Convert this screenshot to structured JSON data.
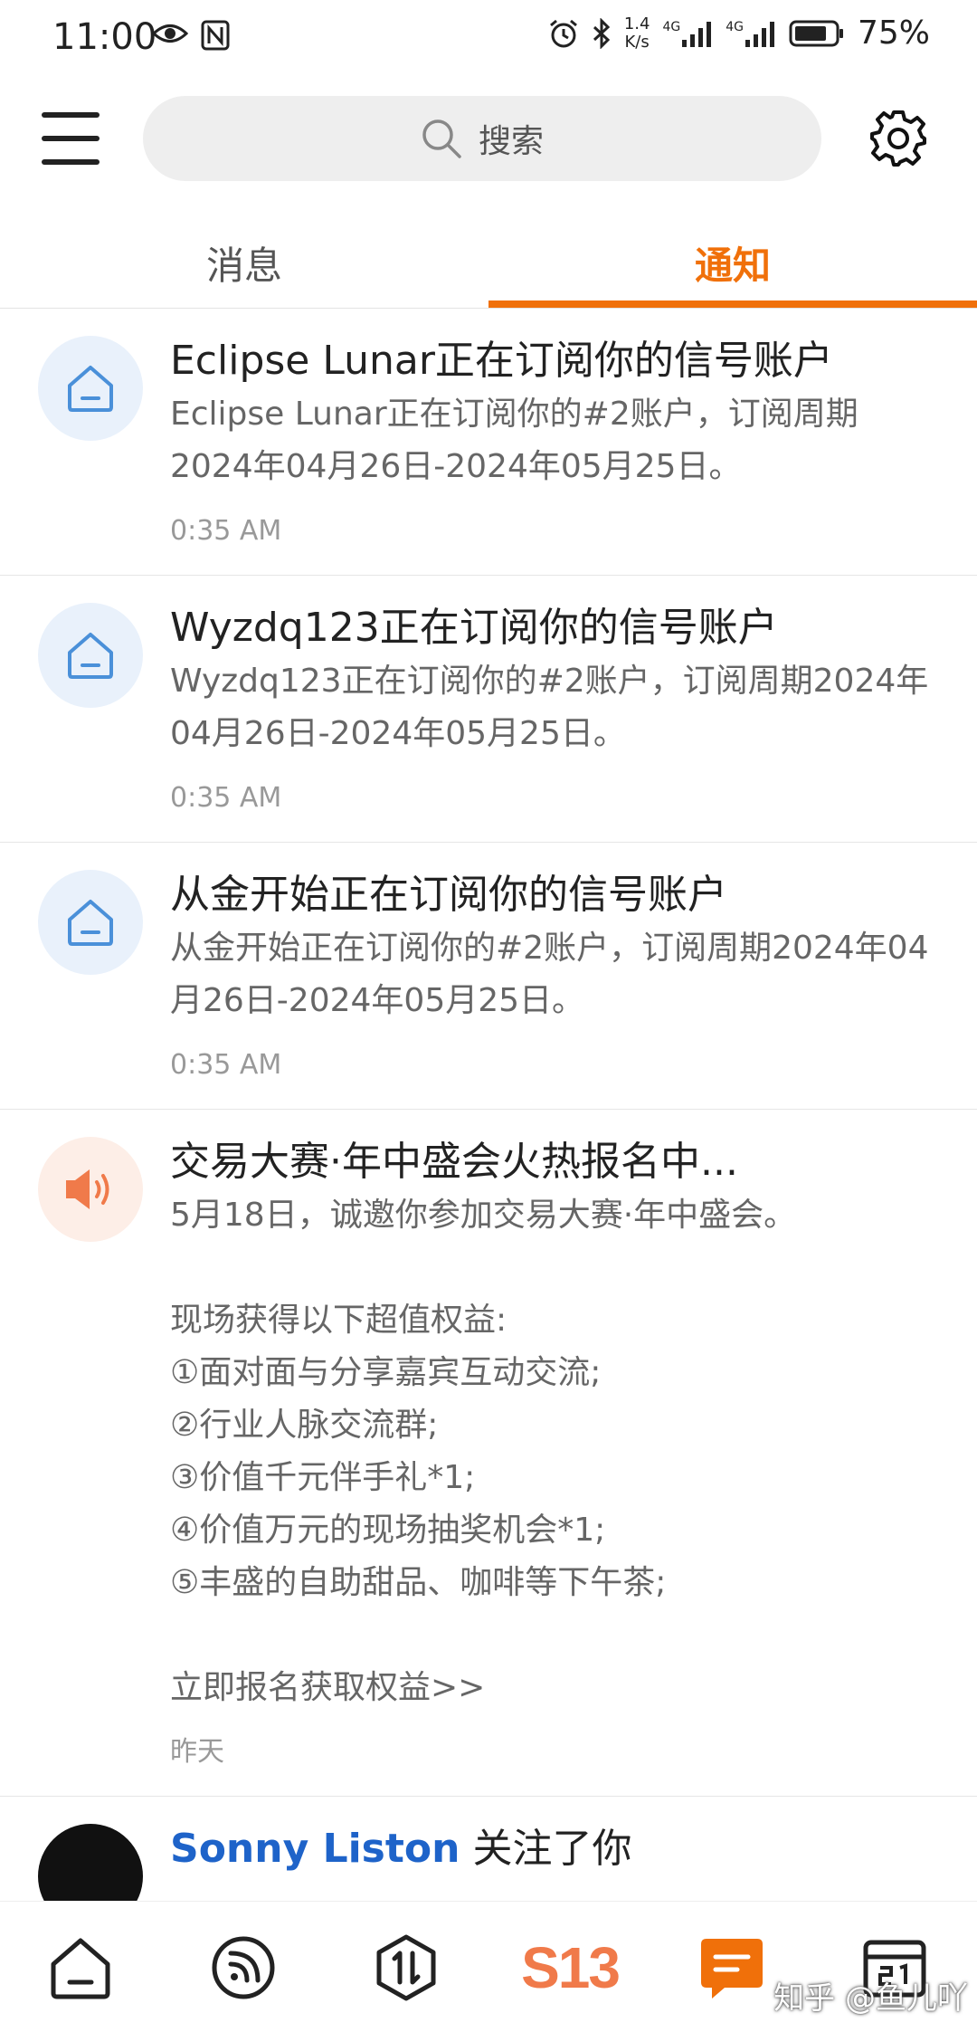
{
  "status_bar": {
    "time": "11:00",
    "speed_top": "1.4",
    "speed_bottom": "K/s",
    "net1": "4G",
    "net2": "4G",
    "battery": "75%"
  },
  "header": {
    "search_placeholder": "搜索"
  },
  "tabs": [
    {
      "label": "消息",
      "active": false
    },
    {
      "label": "通知",
      "active": true
    }
  ],
  "notifications": [
    {
      "icon": "house-icon",
      "title": "Eclipse Lunar正在订阅你的信号账户",
      "content": "Eclipse Lunar正在订阅你的#2账户，订阅周期2024年04月26日-2024年05月25日。",
      "time": "0:35 AM"
    },
    {
      "icon": "house-icon",
      "title": "Wyzdq123正在订阅你的信号账户",
      "content": "Wyzdq123正在订阅你的#2账户，订阅周期2024年04月26日-2024年05月25日。",
      "time": "0:35 AM"
    },
    {
      "icon": "house-icon",
      "title": "从金开始正在订阅你的信号账户",
      "content": "从金开始正在订阅你的#2账户，订阅周期2024年04月26日-2024年05月25日。",
      "time": "0:35 AM"
    },
    {
      "icon": "speaker-icon",
      "title": "交易大赛·年中盛会火热报名中...",
      "content": "5月18日，诚邀你参加交易大赛·年中盛会。\n\n现场获得以下超值权益:\n①面对面与分享嘉宾互动交流;\n②行业人脉交流群;\n③价值千元伴手礼*1;\n④价值万元的现场抽奖机会*1;\n⑤丰盛的自助甜品、咖啡等下午茶;\n\n立即报名获取权益>>",
      "time": "昨天"
    },
    {
      "icon": "user-avatar",
      "title_name": "Sonny Liston",
      "title_rest": " 关注了你"
    }
  ],
  "bottom_nav": {
    "brand_label": "S13",
    "items": [
      "home-icon",
      "feed-icon",
      "trade-icon",
      "s13-logo",
      "message-icon",
      "calendar-icon"
    ]
  },
  "watermark": "知乎 @鱼儿吖",
  "colors": {
    "accent": "#f0700a",
    "link": "#1e63c9",
    "icon_blue": "#4a90d9",
    "speaker_orange": "#f07a4a"
  }
}
